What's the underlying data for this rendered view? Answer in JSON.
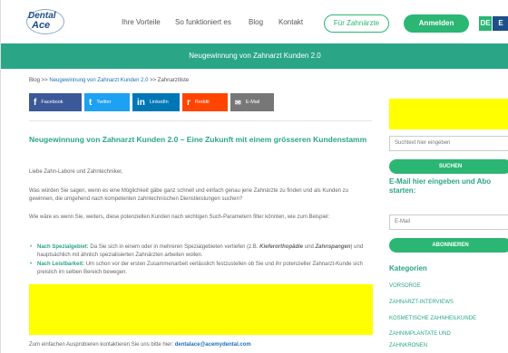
{
  "header": {
    "logo_line1": "Dental",
    "logo_line2": "Ace",
    "nav": [
      "Ihre Vorteile",
      "So funktioniert es",
      "Blog",
      "Kontakt"
    ],
    "cta_outline": "Für Zahnärzte",
    "cta_fill": "Anmelden",
    "lang": [
      "DE",
      "E"
    ]
  },
  "banner": {
    "title": "Neugewinnung von Zahnarzt Kunden 2.0"
  },
  "breadcrumb": {
    "home": "Blog",
    "sep1": " >> ",
    "page": "Neugewinnung von Zahnarzt Kunden 2.0",
    "sep2": " >> ",
    "current": "Zahnarztliste"
  },
  "share": [
    {
      "icon": "f",
      "label": "Facebook",
      "color": "#3b5998"
    },
    {
      "icon": "t",
      "label": "Twitter",
      "color": "#1da1f2"
    },
    {
      "icon": "in",
      "label": "LinkedIn",
      "color": "#0077b5"
    },
    {
      "icon": "r",
      "label": "Reddit",
      "color": "#ff4500"
    },
    {
      "icon": "✉",
      "label": "E-Mail",
      "color": "#777777"
    }
  ],
  "article": {
    "title": "Neugewinnung von Zahnarzt Kunden 2.0 – Eine Zukunft mit einem grösseren Kundenstamm",
    "greeting": "Liebe Zahn-Labore und Zahntechniker,",
    "p1": "Was würden Sie sagen, wenn es eine Möglichkeit gäbe ganz schnell und einfach genau jene Zahnärzte zu finden und als Kunden zu gewinnen, die umgehend nach kompetenten zahntechnischen Dienstleistungen suchen?",
    "p2": "Wie wäre es wenn Sie, weiters, diese potenziellen Kunden nach wichtigen Such-Parametern filter könnten, wie zum Beispiel:",
    "bullet1_head": "Nach Spezialgebiet:",
    "bullet1_a": " Da Sie sich in einem oder in mehreren Spezialgebieten vertiefen (z.B. ",
    "bullet1_b": "Kieferorthopädie",
    "bullet1_c": " und ",
    "bullet1_d": "Zahnspangen",
    "bullet1_e": ") und hauptsächlich mit ähnlich spezialisierten Zahnärzten arbeiten wollen.",
    "bullet2_head": "Nach Leistbarkeit:",
    "bullet2_text": " Um schon vor der ersten Zusammenarbeit verlässlich festzustellen ob Sie und ihr potenzieller Zahnarzt-Kunde sich preislich im selben Bereich bewegen.",
    "contact_text": "Zum einfachen Ausprobieren kontaktieren Sie uns bitte hier: ",
    "contact_email": "dentalace@acemydental.com"
  },
  "sidebar": {
    "search_placeholder": "Suchtext hier eingeben",
    "search_button": "SUCHEN",
    "subscribe_heading": "E-Mail hier eingeben und Abo starten:",
    "email_placeholder": "E-Mail",
    "subscribe_button": "ABONNIEREN",
    "categories_heading": "Kategorien",
    "categories": [
      "VORSORGE",
      "ZAHNARZT-INTERVIEWS",
      "KOSMETISCHE ZAHNHEILKUNDE",
      "ZAHNIMPLANTATE UND",
      "ZAHNKRONEN"
    ]
  }
}
